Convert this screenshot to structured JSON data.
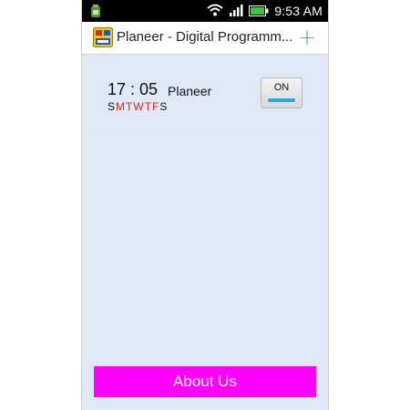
{
  "status_bar": {
    "time": "9:53 AM",
    "icons": [
      "app-notification-icon",
      "wifi-icon",
      "signal-icon",
      "battery-icon"
    ]
  },
  "app_bar": {
    "title": "Planeer - Digital Programm...",
    "app_icon": "dpb-logo-icon",
    "add_icon": "plus-icon",
    "add_label": "+"
  },
  "alarms": [
    {
      "time": "17 : 05",
      "name": "Planeer",
      "days": [
        {
          "label": "S",
          "active": false
        },
        {
          "label": "M",
          "active": true
        },
        {
          "label": "T",
          "active": true
        },
        {
          "label": "W",
          "active": true
        },
        {
          "label": "T",
          "active": true
        },
        {
          "label": "F",
          "active": true
        },
        {
          "label": "S",
          "active": false
        }
      ],
      "toggle": {
        "label": "ON",
        "state": true
      }
    }
  ],
  "about_button": {
    "label": "About Us"
  },
  "colors": {
    "background": "#dfe9f5",
    "accent": "#2aa6e0",
    "active_day": "#e02020",
    "about_button": "#ff00ff"
  }
}
